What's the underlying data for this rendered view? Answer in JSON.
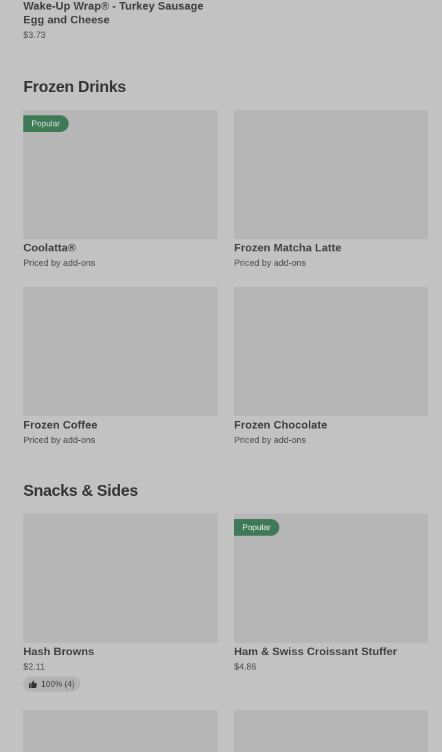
{
  "top_item": {
    "name": "Wake-Up Wrap® - Turkey Sausage Egg and Cheese",
    "price": "$3.73"
  },
  "sections": [
    {
      "title": "Frozen Drinks",
      "items": [
        {
          "name": "Coolatta®",
          "price": "Priced by add-ons",
          "badge": "Popular"
        },
        {
          "name": "Frozen Matcha Latte",
          "price": "Priced by add-ons"
        },
        {
          "name": "Frozen Coffee",
          "price": "Priced by add-ons"
        },
        {
          "name": "Frozen Chocolate",
          "price": "Priced by add-ons"
        }
      ]
    },
    {
      "title": "Snacks & Sides",
      "items": [
        {
          "name": "Hash Browns",
          "price": "$2.11",
          "rating": "100% (4)",
          "rating_icon": "thumbs-up-icon"
        },
        {
          "name": "Ham & Swiss Croissant Stuffer",
          "price": "$4.86",
          "badge": "Popular"
        }
      ]
    }
  ],
  "colors": {
    "background": "#c2c2c2",
    "image_placeholder": "#b6b6b6",
    "badge": "#3f7a57"
  }
}
